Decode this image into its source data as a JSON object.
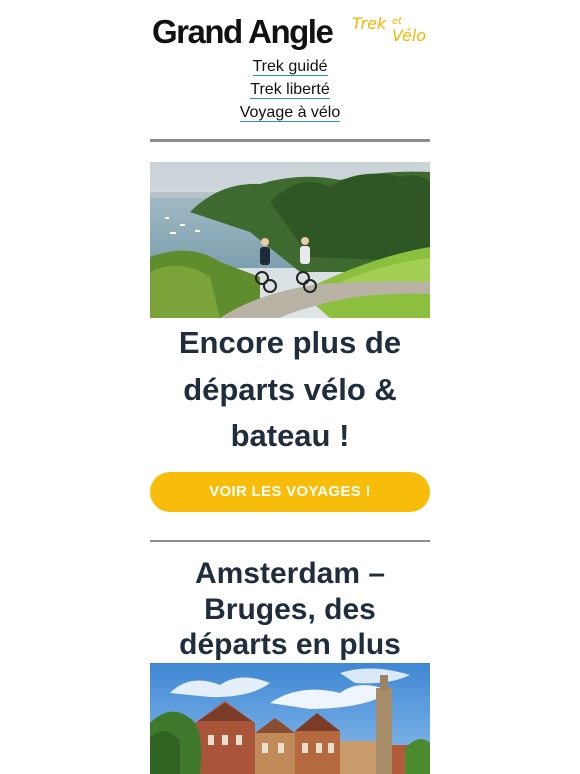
{
  "logo": {
    "main": "Grand Angle",
    "trek": "Trek",
    "et": "et",
    "velo": "Vélo"
  },
  "nav": [
    {
      "label": "Trek guidé"
    },
    {
      "label": "Trek liberté"
    },
    {
      "label": "Voyage à vélo"
    }
  ],
  "hero": {
    "title": "Encore plus de départs vélo & bateau !",
    "cta": "VOIR LES VOYAGES !"
  },
  "section2": {
    "title": "Amsterdam – Bruges, des départs en plus"
  },
  "colors": {
    "accent": "#f8bd0a",
    "heading": "#1f2d3d",
    "link_underline": "#2a8fd6"
  }
}
